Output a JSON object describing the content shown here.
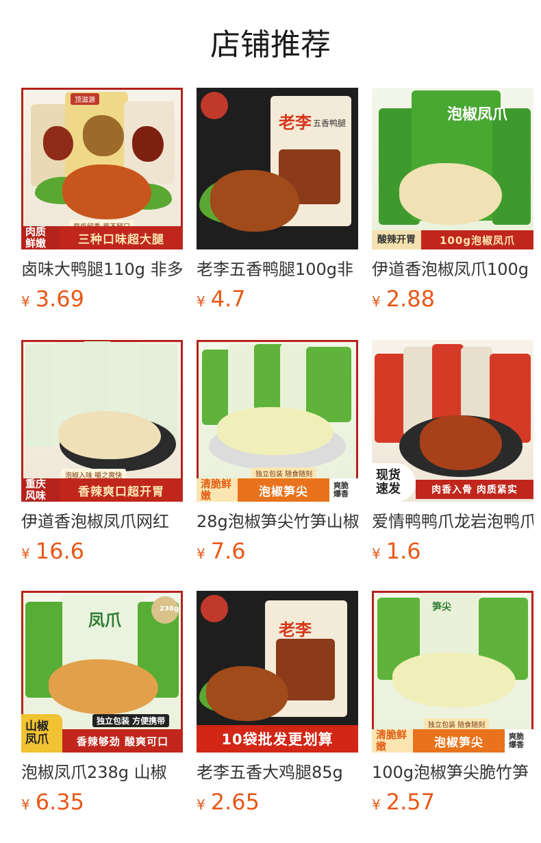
{
  "page": {
    "title": "店铺推荐"
  },
  "currency": "¥",
  "colors": {
    "price": "#e85818",
    "banner_red": "#b4231c",
    "banner_cream": "#fbe6b3"
  },
  "products": [
    {
      "name": "卤味大鸭腿110g 非多",
      "price": "3.69",
      "overlay": {
        "brand_label": "顶滋源",
        "tag_left": "肉质鲜嫩",
        "tag_right": "三种口味超大腿",
        "note": "唇齿留香 爱不释口"
      }
    },
    {
      "name": "老李五香鸭腿100g非",
      "price": "4.7",
      "overlay": {
        "brand_label": "老李",
        "pack_text": "五香鸭腿"
      }
    },
    {
      "name": "伊道香泡椒凤爪100g",
      "price": "2.88",
      "overlay": {
        "pack_text": "泡椒凤爪",
        "tag_left": "酸辣开胃",
        "tag_right": "100g泡椒凤爪"
      }
    },
    {
      "name": "伊道香泡椒凤爪网红",
      "price": "16.6",
      "overlay": {
        "tag_left": "重庆风味",
        "tag_right": "香辣爽口超开胃",
        "note": "泡椒入味 嚼之爽快"
      }
    },
    {
      "name": "28g泡椒笋尖竹笋山椒",
      "price": "7.6",
      "overlay": {
        "tag_left": "清脆鲜嫩",
        "tag_right": "泡椒笋尖",
        "tag_extra": "爽脆爆香",
        "note": "独立包装  随食随刻"
      }
    },
    {
      "name": "爱情鸭鸭爪龙岩泡鸭爪",
      "price": "1.6",
      "overlay": {
        "tag_left": "现货速发",
        "tag_right": "肉香入骨  肉质紧实"
      }
    },
    {
      "name": "泡椒凤爪238g 山椒",
      "price": "6.35",
      "overlay": {
        "pack_text": "凤爪",
        "badge": "238g",
        "tag_left": "山椒凤爪",
        "tag_right": "香辣够劲 酸爽可口",
        "note": "独立包装 方便携带"
      }
    },
    {
      "name": "老李五香大鸡腿85g",
      "price": "2.65",
      "overlay": {
        "brand_label": "老李",
        "tag_right": "10袋批发更划算"
      }
    },
    {
      "name": "100g泡椒笋尖脆竹笋",
      "price": "2.57",
      "overlay": {
        "pack_text": "笋尖",
        "tag_left": "清脆鲜嫩",
        "tag_right": "泡椒笋尖",
        "tag_extra": "爽脆爆香",
        "note": "独立包装  随食随刻"
      }
    }
  ]
}
